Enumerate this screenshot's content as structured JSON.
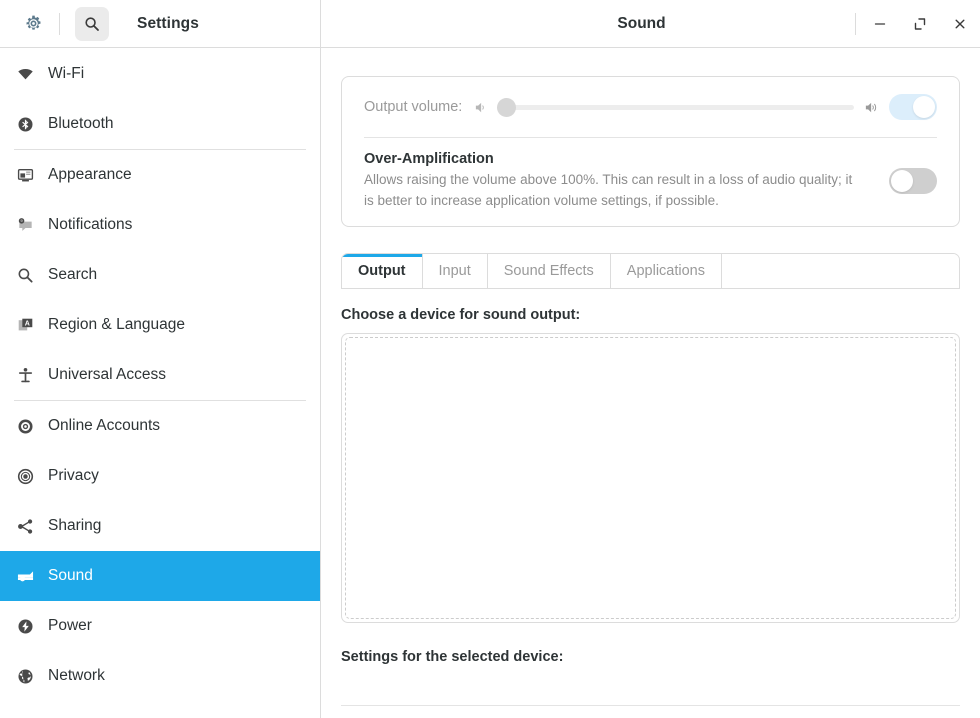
{
  "sidebar": {
    "header": {
      "gear_icon": "gear-icon",
      "search_icon": "search-icon",
      "title": "Settings"
    },
    "groups": [
      {
        "items": [
          {
            "label": "Wi-Fi",
            "icon": "wifi-icon",
            "selected": false
          },
          {
            "label": "Bluetooth",
            "icon": "bluetooth-icon",
            "selected": false
          }
        ]
      },
      {
        "items": [
          {
            "label": "Appearance",
            "icon": "appearance-icon",
            "selected": false
          },
          {
            "label": "Notifications",
            "icon": "notifications-icon",
            "selected": false
          },
          {
            "label": "Search",
            "icon": "search-icon",
            "selected": false
          },
          {
            "label": "Region & Language",
            "icon": "region-language-icon",
            "selected": false
          },
          {
            "label": "Universal Access",
            "icon": "universal-access-icon",
            "selected": false
          }
        ]
      },
      {
        "items": [
          {
            "label": "Online Accounts",
            "icon": "online-accounts-icon",
            "selected": false
          },
          {
            "label": "Privacy",
            "icon": "privacy-icon",
            "selected": false
          },
          {
            "label": "Sharing",
            "icon": "sharing-icon",
            "selected": false
          },
          {
            "label": "Sound",
            "icon": "sound-icon",
            "selected": true
          },
          {
            "label": "Power",
            "icon": "power-icon",
            "selected": false
          },
          {
            "label": "Network",
            "icon": "network-icon",
            "selected": false
          }
        ]
      }
    ]
  },
  "window": {
    "title": "Sound",
    "minimize_label": "–",
    "maximize_label": "maximize-icon",
    "close_label": "×"
  },
  "volume": {
    "label": "Output volume:",
    "value_percent": 0,
    "low_icon": "speaker-low-icon",
    "high_icon": "speaker-high-icon",
    "mute_toggle_state": "on",
    "mute_toggle_enabled": false
  },
  "over_amplification": {
    "title": "Over-Amplification",
    "description": "Allows raising the volume above 100%. This can result in a loss of audio quality; it is better to increase application volume settings, if possible.",
    "toggle_state": "off"
  },
  "tabs": [
    {
      "label": "Output",
      "active": true
    },
    {
      "label": "Input",
      "active": false
    },
    {
      "label": "Sound Effects",
      "active": false
    },
    {
      "label": "Applications",
      "active": false
    }
  ],
  "output_panel": {
    "choose_device_label": "Choose a device for sound output:",
    "device_list_items": [],
    "settings_label": "Settings for the selected device:"
  },
  "colors": {
    "accent": "#1ea8e8",
    "toggle_on_disabled": "#dceefb",
    "toggle_off": "#cfcfcf",
    "text": "#2e3436",
    "muted_text": "#9a9a9a",
    "border": "#dcdcdc"
  }
}
